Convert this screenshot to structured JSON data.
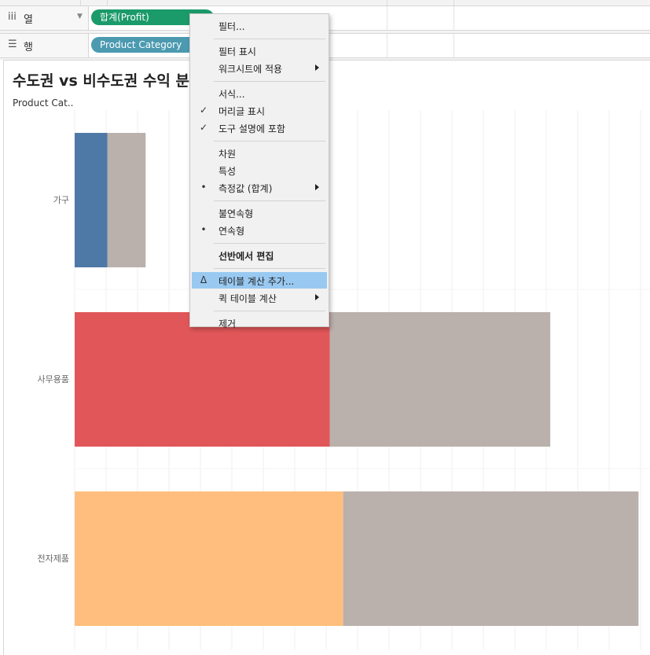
{
  "shelves": {
    "columns": {
      "label": "열",
      "icon": "columns-icon",
      "pill": "합계(Profit)",
      "pill_color": "#1b9a6a"
    },
    "rows": {
      "label": "행",
      "icon": "rows-icon",
      "pill": "Product Category",
      "pill_color": "#4b9ab0"
    }
  },
  "sheet": {
    "title": "수도권 vs 비수도권 수익 분",
    "row_header": "Product Cat.."
  },
  "chart_data": {
    "type": "bar",
    "orientation": "horizontal",
    "stacked": true,
    "categories": [
      "가구",
      "사무용품",
      "전자제품"
    ],
    "series": [
      {
        "colors": [
          "#4e79a7",
          "#e15759",
          "#ffbe7d"
        ],
        "values": [
          0.85,
          6.65,
          7.0
        ]
      },
      {
        "color": "#bab0ac",
        "values": [
          1.0,
          5.75,
          7.7
        ]
      }
    ],
    "xlim": [
      0,
      15
    ],
    "grid": true,
    "axis_labels_visible": false
  },
  "context_menu": {
    "items": [
      {
        "label": "필터...",
        "mark": "",
        "submenu": false,
        "highlighted": false,
        "bold": false
      },
      {
        "separator": true
      },
      {
        "label": "필터 표시",
        "mark": "",
        "submenu": false,
        "highlighted": false,
        "bold": false
      },
      {
        "label": "워크시트에 적용",
        "mark": "",
        "submenu": true,
        "highlighted": false,
        "bold": false
      },
      {
        "separator": true
      },
      {
        "label": "서식...",
        "mark": "",
        "submenu": false,
        "highlighted": false,
        "bold": false
      },
      {
        "label": "머리글 표시",
        "mark": "✓",
        "submenu": false,
        "highlighted": false,
        "bold": false
      },
      {
        "label": "도구 설명에 포함",
        "mark": "✓",
        "submenu": false,
        "highlighted": false,
        "bold": false
      },
      {
        "separator": true
      },
      {
        "label": "차원",
        "mark": "",
        "submenu": false,
        "highlighted": false,
        "bold": false
      },
      {
        "label": "특성",
        "mark": "",
        "submenu": false,
        "highlighted": false,
        "bold": false
      },
      {
        "label": "측정값 (합계)",
        "mark": "•",
        "submenu": true,
        "highlighted": false,
        "bold": false
      },
      {
        "separator": true
      },
      {
        "label": "불연속형",
        "mark": "",
        "submenu": false,
        "highlighted": false,
        "bold": false
      },
      {
        "label": "연속형",
        "mark": "•",
        "submenu": false,
        "highlighted": false,
        "bold": false
      },
      {
        "separator": true
      },
      {
        "label": "선반에서 편집",
        "mark": "",
        "submenu": false,
        "highlighted": false,
        "bold": true
      },
      {
        "separator": true
      },
      {
        "label": "테이블 계산 추가...",
        "mark": "Δ",
        "submenu": false,
        "highlighted": true,
        "bold": false
      },
      {
        "label": "퀵 테이블 계산",
        "mark": "",
        "submenu": true,
        "highlighted": false,
        "bold": false
      },
      {
        "separator": true
      },
      {
        "label": "제거",
        "mark": "",
        "submenu": false,
        "highlighted": false,
        "bold": false
      }
    ]
  }
}
